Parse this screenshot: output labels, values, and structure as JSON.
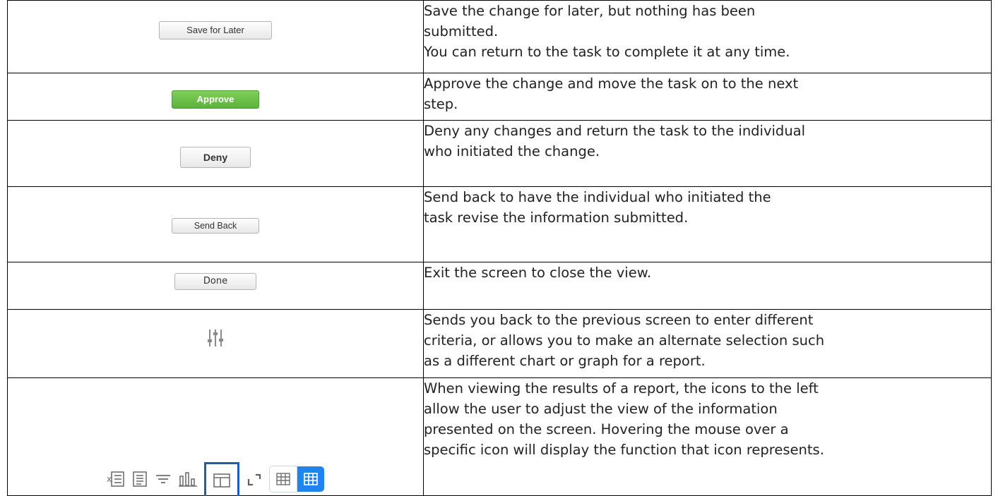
{
  "rows": [
    {
      "button_label": "Save for Later",
      "lines": [
        "Save the change for later, but nothing has been",
        "submitted.",
        "You can return to the task to complete it at any time."
      ]
    },
    {
      "button_label": "Approve",
      "lines": [
        "Approve the change and move the task on to the next",
        "step."
      ]
    },
    {
      "button_label": "Deny",
      "lines": [
        "Deny any changes and return the task to the individual",
        "who initiated the change."
      ]
    },
    {
      "button_label": "Send Back",
      "lines": [
        "Send back to have the individual who initiated the",
        "task revise the information submitted."
      ]
    },
    {
      "button_label": "Done",
      "lines": [
        "Exit the screen to close the view."
      ]
    },
    {
      "icon": "adjust-sliders-icon",
      "lines": [
        "Sends you back to the previous screen to enter different",
        "criteria, or allows you to make an alternate selection such",
        "as a different chart or graph for a report."
      ]
    },
    {
      "icons": [
        "export-excel-icon",
        "pdf-list-icon",
        "filter-icon",
        "chart-icon",
        "table-layout-icon",
        "expand-icon",
        "grid-view-icon",
        "grid-view-selected-icon"
      ],
      "lines": [
        "When viewing the results of a report, the icons to the left",
        "allow the user to adjust the view of the information",
        "presented on the screen. Hovering the mouse over a",
        "specific icon will display the function that icon represents."
      ]
    }
  ],
  "colors": {
    "approve_green": "#5cb33c",
    "selected_border_blue": "#1f5ea8",
    "grid_selected_blue": "#1f83f0",
    "icon_gray": "#7a7a7a"
  }
}
